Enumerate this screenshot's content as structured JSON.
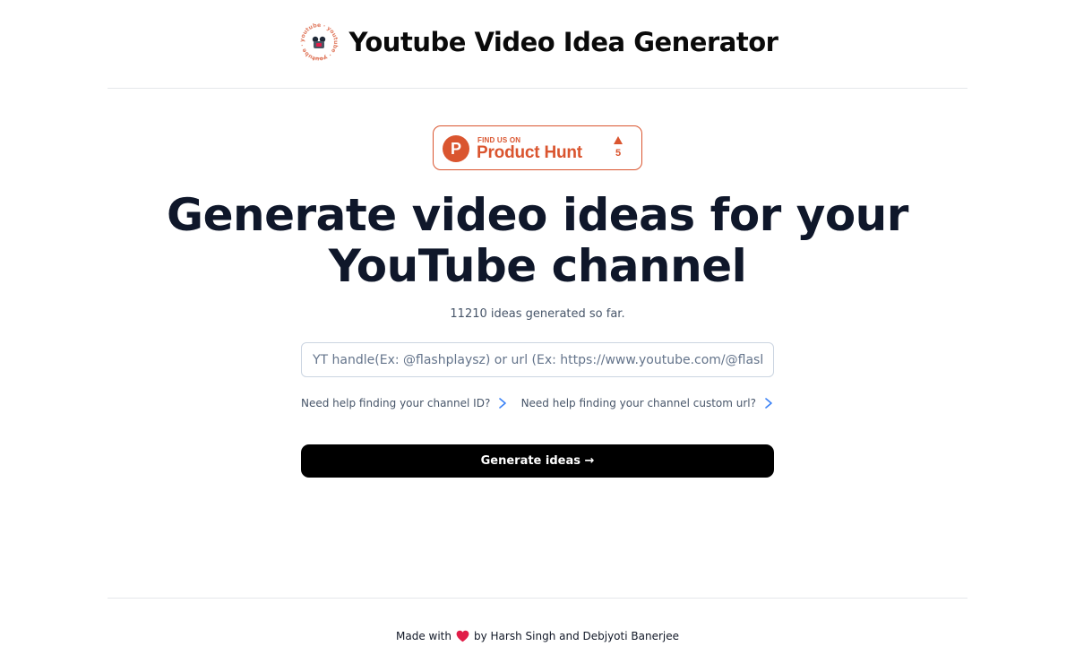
{
  "header": {
    "title": "Youtube Video Idea Generator",
    "logo": {
      "icon": "youtube-logo-icon",
      "ring_text": "youtube · youtube"
    }
  },
  "product_hunt": {
    "small_label": "FIND US ON",
    "name": "Product Hunt",
    "logo_letter": "P",
    "upvotes": "5",
    "color": "#da552f"
  },
  "hero": {
    "title": "Generate video ideas for your YouTube channel",
    "counter": "11210 ideas generated so far."
  },
  "form": {
    "placeholder": "YT handle(Ex: @flashplaysz) or url (Ex: https://www.youtube.com/@flashplaysz)",
    "help_links": [
      {
        "label": "Need help finding your channel ID?",
        "icon": "chevron-right-icon"
      },
      {
        "label": "Need help finding your channel custom url?",
        "icon": "chevron-right-icon"
      }
    ],
    "submit_label": "Generate ideas →"
  },
  "footer": {
    "prefix": "Made with",
    "icon": "heart-icon",
    "suffix": "by Harsh Singh and Debjyoti Banerjee",
    "heart_color": "#e11d48"
  }
}
